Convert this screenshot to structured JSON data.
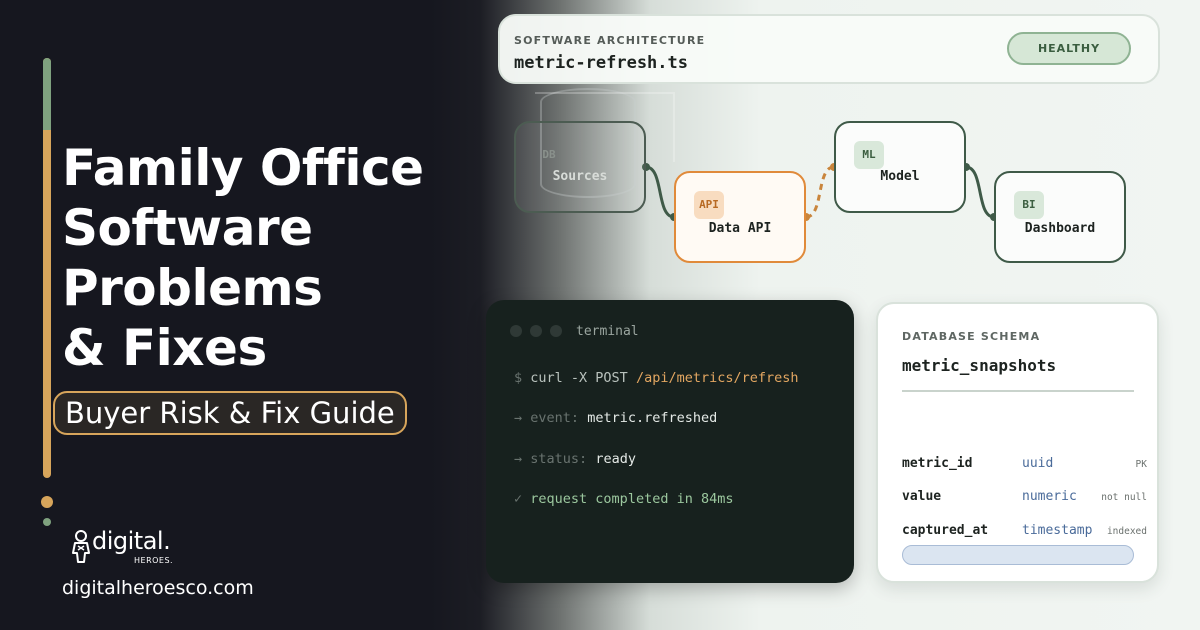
{
  "hero": {
    "title_lines": [
      "Family Office",
      "Software",
      "Problems",
      "& Fixes"
    ],
    "badge": "Buyer Risk & Fix Guide"
  },
  "brand": {
    "logo_word": "digital.",
    "logo_sub": "HEROES.",
    "url": "digitalheroesco.com"
  },
  "header": {
    "kicker": "SOFTWARE ARCHITECTURE",
    "file": "metric-refresh.ts",
    "status": "HEALTHY"
  },
  "pipeline": {
    "nodes": [
      {
        "tag": "DB",
        "label": "Sources"
      },
      {
        "tag": "API",
        "label": "Data API"
      },
      {
        "tag": "ML",
        "label": "Model"
      },
      {
        "tag": "BI",
        "label": "Dashboard"
      }
    ]
  },
  "terminal": {
    "title": "terminal",
    "lines": [
      {
        "prefix": "$",
        "text": "curl -X POST",
        "accent": "/api/metrics/refresh"
      },
      {
        "prefix": "→",
        "text": "event:",
        "accent": "metric.refreshed"
      },
      {
        "prefix": "→",
        "text": "status:",
        "accent": "ready"
      },
      {
        "prefix": "✓",
        "text": "request completed in 84ms",
        "accent": ""
      }
    ]
  },
  "schema": {
    "kicker": "DATABASE SCHEMA",
    "table": "metric_snapshots",
    "columns": [
      {
        "name": "metric_id",
        "type": "uuid",
        "flag": "PK"
      },
      {
        "name": "value",
        "type": "numeric",
        "flag": "not null"
      },
      {
        "name": "captured_at",
        "type": "timestamp",
        "flag": "indexed"
      }
    ]
  },
  "colors": {
    "accent_orange": "#d7a55b",
    "accent_green": "#7fa27f",
    "dark_bg": "#16171f",
    "healthy_bg": "#d6e7d6",
    "api_orange": "#e08a3a"
  }
}
